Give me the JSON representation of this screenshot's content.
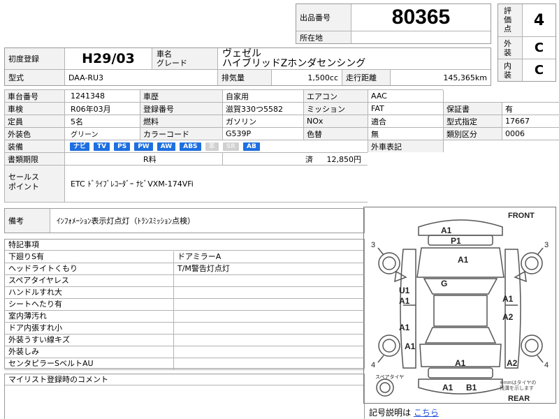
{
  "header": {
    "lot_label": "出品番号",
    "lot_number": "80365",
    "location_label": "所在地",
    "location_value": "",
    "score_label": "評価点",
    "score_value": "4",
    "exterior_label": "外装",
    "exterior_value": "C",
    "interior_label": "内装",
    "interior_value": "C"
  },
  "vehicle": {
    "first_reg_label": "初度登録",
    "first_reg_value": "H29/03",
    "name_label": "車名",
    "grade_label": "グレード",
    "name_value": "ヴェゼル",
    "grade_value": "ハイブリッドZホンダセンシング",
    "model_label": "型式",
    "model_value": "DAA-RU3",
    "displacement_label": "排気量",
    "displacement_value": "1,500cc",
    "mileage_label": "走行距離",
    "mileage_value": "145,365km"
  },
  "details": {
    "chassis_label": "車台番号",
    "chassis_value": "1241348",
    "history_label": "車歴",
    "history_value": "自家用",
    "ac_label": "エアコン",
    "ac_value": "AAC",
    "inspection_label": "車検",
    "inspection_value": "R06年03月",
    "plate_label": "登録番号",
    "plate_value": "滋賀330つ5582",
    "mission_label": "ミッション",
    "mission_value": "FAT",
    "warranty_label": "保証書",
    "warranty_value": "有",
    "capacity_label": "定員",
    "capacity_value": "5名",
    "fuel_label": "燃料",
    "fuel_value": "ガソリン",
    "nox_label": "NOx",
    "nox_value": "適合",
    "type_spec_label": "型式指定",
    "type_spec_value": "17667",
    "color_label": "外装色",
    "color_value": "グリーン",
    "color_code_label": "カラーコード",
    "color_code_value": "G539P",
    "repaint_label": "色替",
    "repaint_value": "無",
    "category_label": "類別区分",
    "category_value": "0006",
    "equipment_label": "装備",
    "equipment": [
      {
        "label": "ナビ",
        "active": true
      },
      {
        "label": "TV",
        "active": true
      },
      {
        "label": "PS",
        "active": true
      },
      {
        "label": "PW",
        "active": true
      },
      {
        "label": "AW",
        "active": true
      },
      {
        "label": "ABS",
        "active": true
      },
      {
        "label": "革",
        "active": false
      },
      {
        "label": "SR",
        "active": false
      },
      {
        "label": "AB",
        "active": true
      }
    ],
    "foreign_label": "外車表記",
    "documents_label": "書類期限",
    "recycle_label": "R料",
    "recycle_status": "済",
    "recycle_amount": "12,850円"
  },
  "sales": {
    "label": "セールス\nポイント",
    "value": "ETC ﾄﾞﾗｲﾌﾞﾚｺｰﾀﾞｰ ﾅﾋﾞVXM-174VFi"
  },
  "notes": {
    "label": "備考",
    "value": "ｲﾝﾌｫﾒｰｼｮﾝ表示灯点灯（ﾄﾗﾝｽﾐｯｼｮﾝ点検）"
  },
  "special": {
    "title": "特記事項",
    "left": [
      "下廻りS有",
      "ヘッドライトくもり",
      "スペアタイヤレス",
      "ハンドルすれ大",
      "シートへたり有",
      "室内薄汚れ",
      "ドア内張すれ小",
      "外装うすい線キズ",
      "外装しみ",
      "センタピラーSベルトAU"
    ],
    "right": [
      "ドアミラーA",
      "T/M警告灯点灯",
      "",
      "",
      "",
      "",
      "",
      "",
      "",
      ""
    ]
  },
  "comment": {
    "title": "マイリスト登録時のコメント"
  },
  "diagram": {
    "front_label": "FRONT",
    "rear_label": "REAR",
    "spare_label": "スペアタイヤ",
    "note_label": "※mmはタイヤの\n残溝を示します",
    "tire_fl": "3",
    "tire_fr": "3",
    "tire_rl": "4",
    "tire_rr": "4",
    "marks": {
      "front_bumper": "A1",
      "front_grille": "P1",
      "hood": "A1",
      "roof": "G",
      "left_front_u": "U1",
      "left_front_a": "A1",
      "left_rear_door": "A1",
      "left_rear_a": "A1",
      "right_front": "A1",
      "right_rear_door": "A2",
      "right_rear_a": "A2",
      "rear_a": "A1",
      "rear_left": "A1",
      "rear_bumper_b": "B1"
    },
    "legend_label": "記号説明は",
    "legend_link": "こちら"
  }
}
